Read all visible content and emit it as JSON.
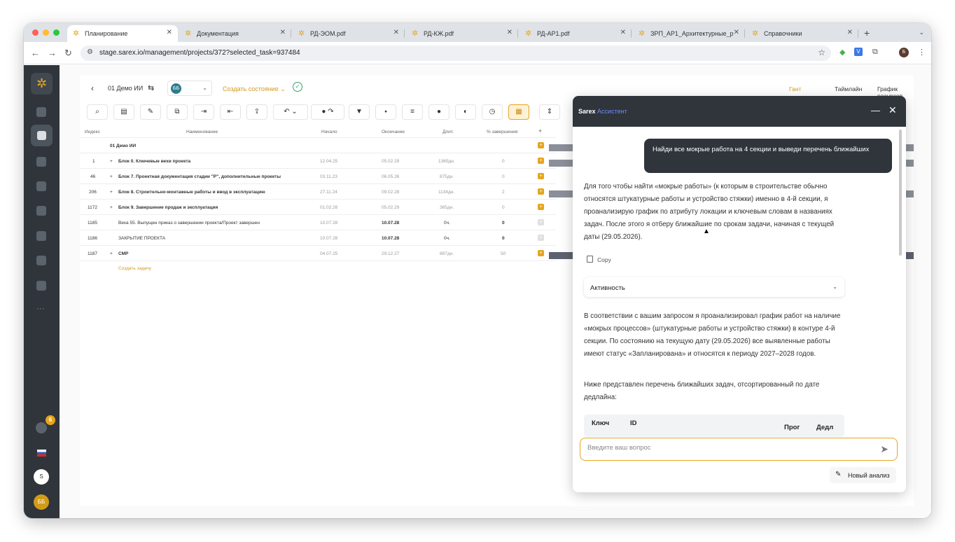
{
  "browser": {
    "tabs": [
      {
        "title": "Планирование",
        "active": true
      },
      {
        "title": "Документация"
      },
      {
        "title": "РД-ЭОМ.pdf"
      },
      {
        "title": "РД-КЖ.pdf"
      },
      {
        "title": "РД-АР1.pdf"
      },
      {
        "title": "ЗРП_АР1_Архитектурные_р"
      },
      {
        "title": "Справочники"
      }
    ],
    "url": "stage.sarex.io/management/projects/372?selected_task=937484",
    "profile_initial": "Б"
  },
  "sidebar": {
    "logo_icon": "sarex-logo",
    "notification_count": "6",
    "s_avatar": "S",
    "user_avatar": "ББ"
  },
  "topbar": {
    "project": "01 Демо ИИ",
    "version_badge": "ББ",
    "create_state": "Создать состояние",
    "views": [
      "Гант",
      "Таймлайн",
      "График ресурсов"
    ],
    "active_view": "Гант"
  },
  "table": {
    "headers": [
      "Индекс",
      "Наименование",
      "Начало",
      "Окончание",
      "Длит.",
      "% завершения"
    ],
    "rows": [
      {
        "index": "",
        "name": "01 Демо ИИ",
        "start": "",
        "end": "",
        "dur": "",
        "pct": "",
        "expand": ""
      },
      {
        "index": "1",
        "name": "Блок 0. Ключевые вехи проекта",
        "start": "12.04.25",
        "end": "05.02.29",
        "dur": "1365дн.",
        "pct": "0",
        "expand": "+"
      },
      {
        "index": "46",
        "name": "Блок 7. Проектная документация стадии \"Р\", дополнительные проекты",
        "start": "03.11.23",
        "end": "06.05.26",
        "dur": "875дн.",
        "pct": "0",
        "expand": "+"
      },
      {
        "index": "206",
        "name": "Блок 8. Строительно-монтажные работы и ввод в эксплуатацию",
        "start": "27.11.24",
        "end": "09.02.28",
        "dur": "1134дн.",
        "pct": "2",
        "expand": "+"
      },
      {
        "index": "1172",
        "name": "Блок 9. Завершение продаж и эксплуатация",
        "start": "01.02.28",
        "end": "05.02.29",
        "dur": "365дн.",
        "pct": "0",
        "expand": "+"
      },
      {
        "index": "1185",
        "name": "Веха 55. Выпущен приказ о завершении проекта/Проект завершен",
        "start": "10.07.28",
        "end": "10.07.28",
        "dur": "0ч.",
        "pct": "0",
        "expand": ""
      },
      {
        "index": "1186",
        "name": "ЗАКРЫТИЕ ПРОЕКТА",
        "start": "10.07.28",
        "end": "10.07.28",
        "dur": "0ч.",
        "pct": "0",
        "expand": ""
      },
      {
        "index": "1187",
        "name": "СМР",
        "start": "04.07.25",
        "end": "29.12.27",
        "dur": "887дн.",
        "pct": "50",
        "expand": "+"
      }
    ],
    "add_task": "Создать задачу"
  },
  "assistant": {
    "title_brand": "Sarex",
    "title_accent": "Ассистент",
    "user_message": "Найди все мокрые работа на 4 секции и выведи перечень ближайших",
    "reply_1": "Для того чтобы найти «мокрые работы» (к которым в строительстве обычно относятся штукатурные работы и устройство стяжки) именно в 4-й секции, я проанализирую график по атрибуту локации и ключевым словам в названиях задач. После этого я отберу ближайшие по срокам задачи, начиная с текущей даты (29.05.2026).",
    "copy_label": "Copy",
    "activity_label": "Активность",
    "reply_2": "В соответствии с вашим запросом я проанализировал график работ на наличие «мокрых процессов» (штукатурные работы и устройство стяжки) в контуре 4-й секции. По состоянию на текущую дату (29.05.2026) все выявленные работы имеют статус «Запланирована» и относятся к периоду 2027–2028 годов.",
    "reply_3": "Ниже представлен перечень ближайших задач, отсортированный по дате дедлайна:",
    "mini_table_headers": [
      "Ключ",
      "ID",
      "Прог",
      "Дедл"
    ],
    "input_placeholder": "Введите ваш вопрос",
    "new_analysis": "Новый анализ"
  }
}
